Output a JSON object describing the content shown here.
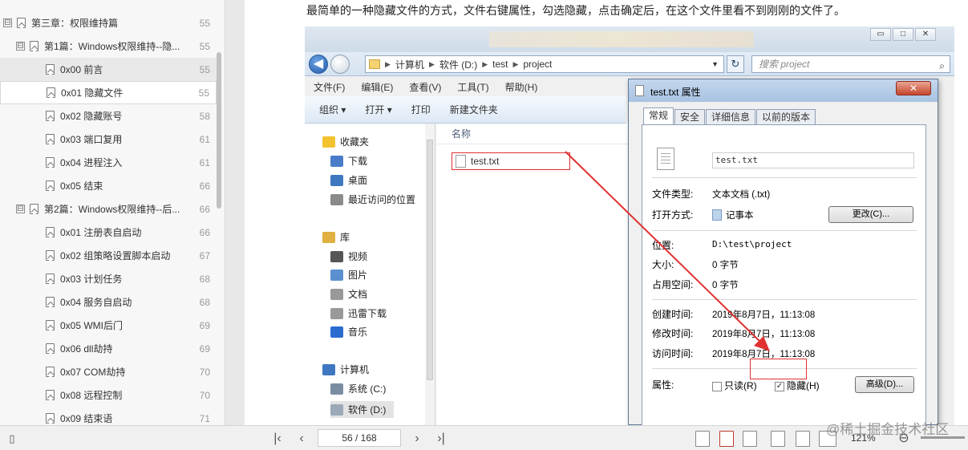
{
  "toc": {
    "items": [
      {
        "label": "第三章：权限维持篇",
        "page": "55",
        "level": 0,
        "toggle": "⊟"
      },
      {
        "label": "第1篇：Windows权限维持--隐...",
        "page": "55",
        "level": 1,
        "toggle": "⊟"
      },
      {
        "label": "0x00 前言",
        "page": "55",
        "level": 2
      },
      {
        "label": "0x01 隐藏文件",
        "page": "55",
        "level": 2
      },
      {
        "label": "0x02 隐藏账号",
        "page": "58",
        "level": 2
      },
      {
        "label": "0x03 端口复用",
        "page": "61",
        "level": 2
      },
      {
        "label": "0x04 进程注入",
        "page": "61",
        "level": 2
      },
      {
        "label": "0x05  结束",
        "page": "66",
        "level": 2
      },
      {
        "label": "第2篇：Windows权限维持--后...",
        "page": "66",
        "level": 1,
        "toggle": "⊟"
      },
      {
        "label": "0x01 注册表自启动",
        "page": "66",
        "level": 2
      },
      {
        "label": "0x02 组策略设置脚本启动",
        "page": "67",
        "level": 2
      },
      {
        "label": "0x03 计划任务",
        "page": "68",
        "level": 2
      },
      {
        "label": "0x04 服务自启动",
        "page": "68",
        "level": 2
      },
      {
        "label": "0x05 WMI后门",
        "page": "69",
        "level": 2
      },
      {
        "label": "0x06 dll劫持",
        "page": "69",
        "level": 2
      },
      {
        "label": "0x07 COM劫持",
        "page": "70",
        "level": 2
      },
      {
        "label": "0x08 远程控制",
        "page": "70",
        "level": 2
      },
      {
        "label": "0x09 结束语",
        "page": "71",
        "level": 2
      }
    ]
  },
  "doc": {
    "intro": "最简单的一种隐藏文件的方式，文件右键属性，勾选隐藏，点击确定后，在这个文件里看不到刚刚的文件了。"
  },
  "explorer": {
    "window_buttons": [
      "▭",
      "□",
      "✕"
    ],
    "address": [
      "计算机",
      "软件 (D:)",
      "test",
      "project"
    ],
    "search_placeholder": "搜索 project",
    "menu": [
      "文件(F)",
      "编辑(E)",
      "查看(V)",
      "工具(T)",
      "帮助(H)"
    ],
    "commands": [
      "组织 ▾",
      "打开 ▾",
      "打印",
      "新建文件夹"
    ],
    "nav": [
      {
        "label": "收藏夹",
        "icon": "star-icon",
        "color": "#f2c230"
      },
      {
        "label": "下载",
        "icon": "download-folder-icon",
        "color": "#4a7cc9"
      },
      {
        "label": "桌面",
        "icon": "desktop-icon",
        "color": "#3f78c0"
      },
      {
        "label": "最近访问的位置",
        "icon": "recent-places-icon",
        "color": "#8a8a8a"
      },
      {
        "label": "库",
        "icon": "library-icon",
        "color": "#e0b040"
      },
      {
        "label": "视频",
        "icon": "video-icon",
        "color": "#555"
      },
      {
        "label": "图片",
        "icon": "pictures-icon",
        "color": "#5a8fd0"
      },
      {
        "label": "文档",
        "icon": "documents-icon",
        "color": "#999"
      },
      {
        "label": "迅雷下载",
        "icon": "thunder-download-icon",
        "color": "#999"
      },
      {
        "label": "音乐",
        "icon": "music-icon",
        "color": "#2a6bd0"
      },
      {
        "label": "计算机",
        "icon": "computer-icon",
        "color": "#3f78c0"
      },
      {
        "label": "系统 (C:)",
        "icon": "drive-c-icon",
        "color": "#7b8da3"
      },
      {
        "label": "软件 (D:)",
        "icon": "drive-d-icon",
        "color": "#9aa8b8"
      }
    ],
    "column_header": "名称",
    "file_name": "test.txt"
  },
  "properties": {
    "title": "test.txt 属性",
    "close": "✕",
    "tabs": [
      "常规",
      "安全",
      "详细信息",
      "以前的版本"
    ],
    "file_name": "test.txt",
    "type_label": "文件类型:",
    "type_value": "文本文档 (.txt)",
    "open_label": "打开方式:",
    "open_value": "记事本",
    "change_button": "更改(C)...",
    "location_label": "位置:",
    "location_value": "D:\\test\\project",
    "size_label": "大小:",
    "size_value": "0 字节",
    "disk_label": "占用空间:",
    "disk_value": "0 字节",
    "created_label": "创建时间:",
    "created_value": "2019年8月7日，11:13:08",
    "modified_label": "修改时间:",
    "modified_value": "2019年8月7日，11:13:08",
    "accessed_label": "访问时间:",
    "accessed_value": "2019年8月7日，11:13:08",
    "attr_label": "属性:",
    "readonly_label": "只读(R)",
    "hidden_label": "隐藏(H)",
    "advanced_button": "高级(D)..."
  },
  "statusbar": {
    "page_indicator": "56 / 168",
    "zoom": "121%",
    "watermark": "@稀土掘金技术社区"
  }
}
